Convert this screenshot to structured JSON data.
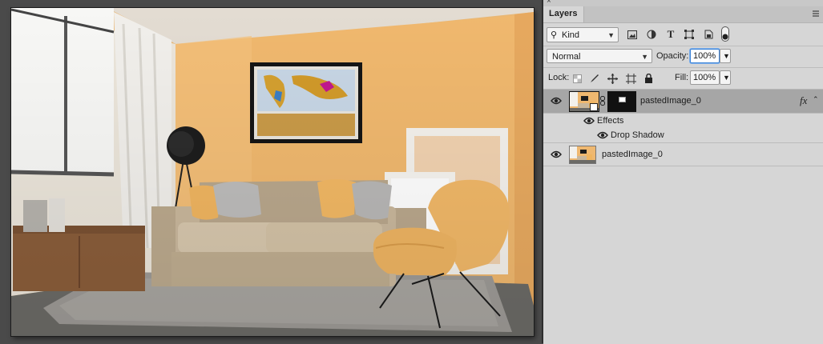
{
  "panel": {
    "close_glyph": "×",
    "tab_label": "Layers",
    "menu_icon": "panel-menu-icon"
  },
  "filter": {
    "kind_label": "Kind",
    "icons": [
      "image-filter-icon",
      "adjustment-filter-icon",
      "type-filter-icon",
      "shape-filter-icon",
      "smart-object-filter-icon",
      "filter-toggle-icon"
    ]
  },
  "blend": {
    "mode": "Normal",
    "opacity_label": "Opacity:",
    "opacity_value": "100%"
  },
  "lock": {
    "label": "Lock:",
    "fill_label": "Fill:",
    "fill_value": "100%",
    "icons": [
      "lock-transparency-icon",
      "lock-pixels-icon",
      "lock-position-icon",
      "lock-artboard-icon",
      "lock-all-icon"
    ]
  },
  "layers": [
    {
      "name": "pastedImage_0",
      "selected": true,
      "fx": "fx",
      "effects_label": "Effects",
      "effect_items": [
        "Drop Shadow"
      ]
    },
    {
      "name": "pastedImage_0",
      "selected": false
    }
  ],
  "colors": {
    "panel_bg": "#d6d6d6",
    "selected_row": "#a6a6a6",
    "wall": "#efb870",
    "sofa": "#c9b79c",
    "chair": "#efb66a",
    "rug": "#9d9a96"
  }
}
